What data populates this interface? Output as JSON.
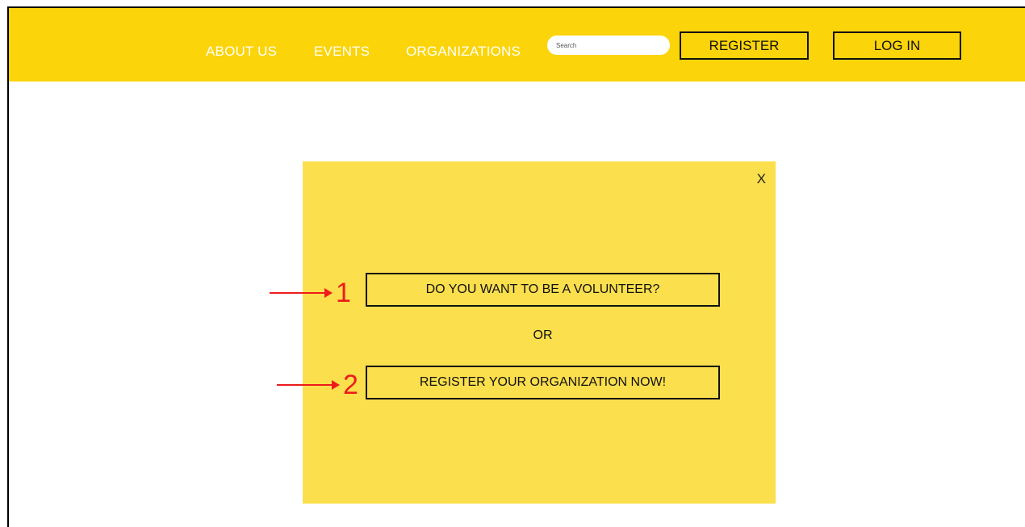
{
  "header": {
    "nav": [
      "ABOUT US",
      "EVENTS",
      "ORGANIZATIONS"
    ],
    "search": {
      "placeholder": "Search",
      "value": ""
    },
    "register_label": "REGISTER",
    "login_label": "LOG IN"
  },
  "modal": {
    "close_label": "X",
    "volunteer_label": "DO YOU WANT TO BE A VOLUNTEER?",
    "or_label": "OR",
    "register_org_label": "REGISTER YOUR ORGANIZATION NOW!"
  },
  "annotations": [
    {
      "number": "1"
    },
    {
      "number": "2"
    }
  ],
  "colors": {
    "header_bg": "#fbd40a",
    "modal_bg": "#fbdf4d",
    "annotation": "#ee1b1b"
  }
}
